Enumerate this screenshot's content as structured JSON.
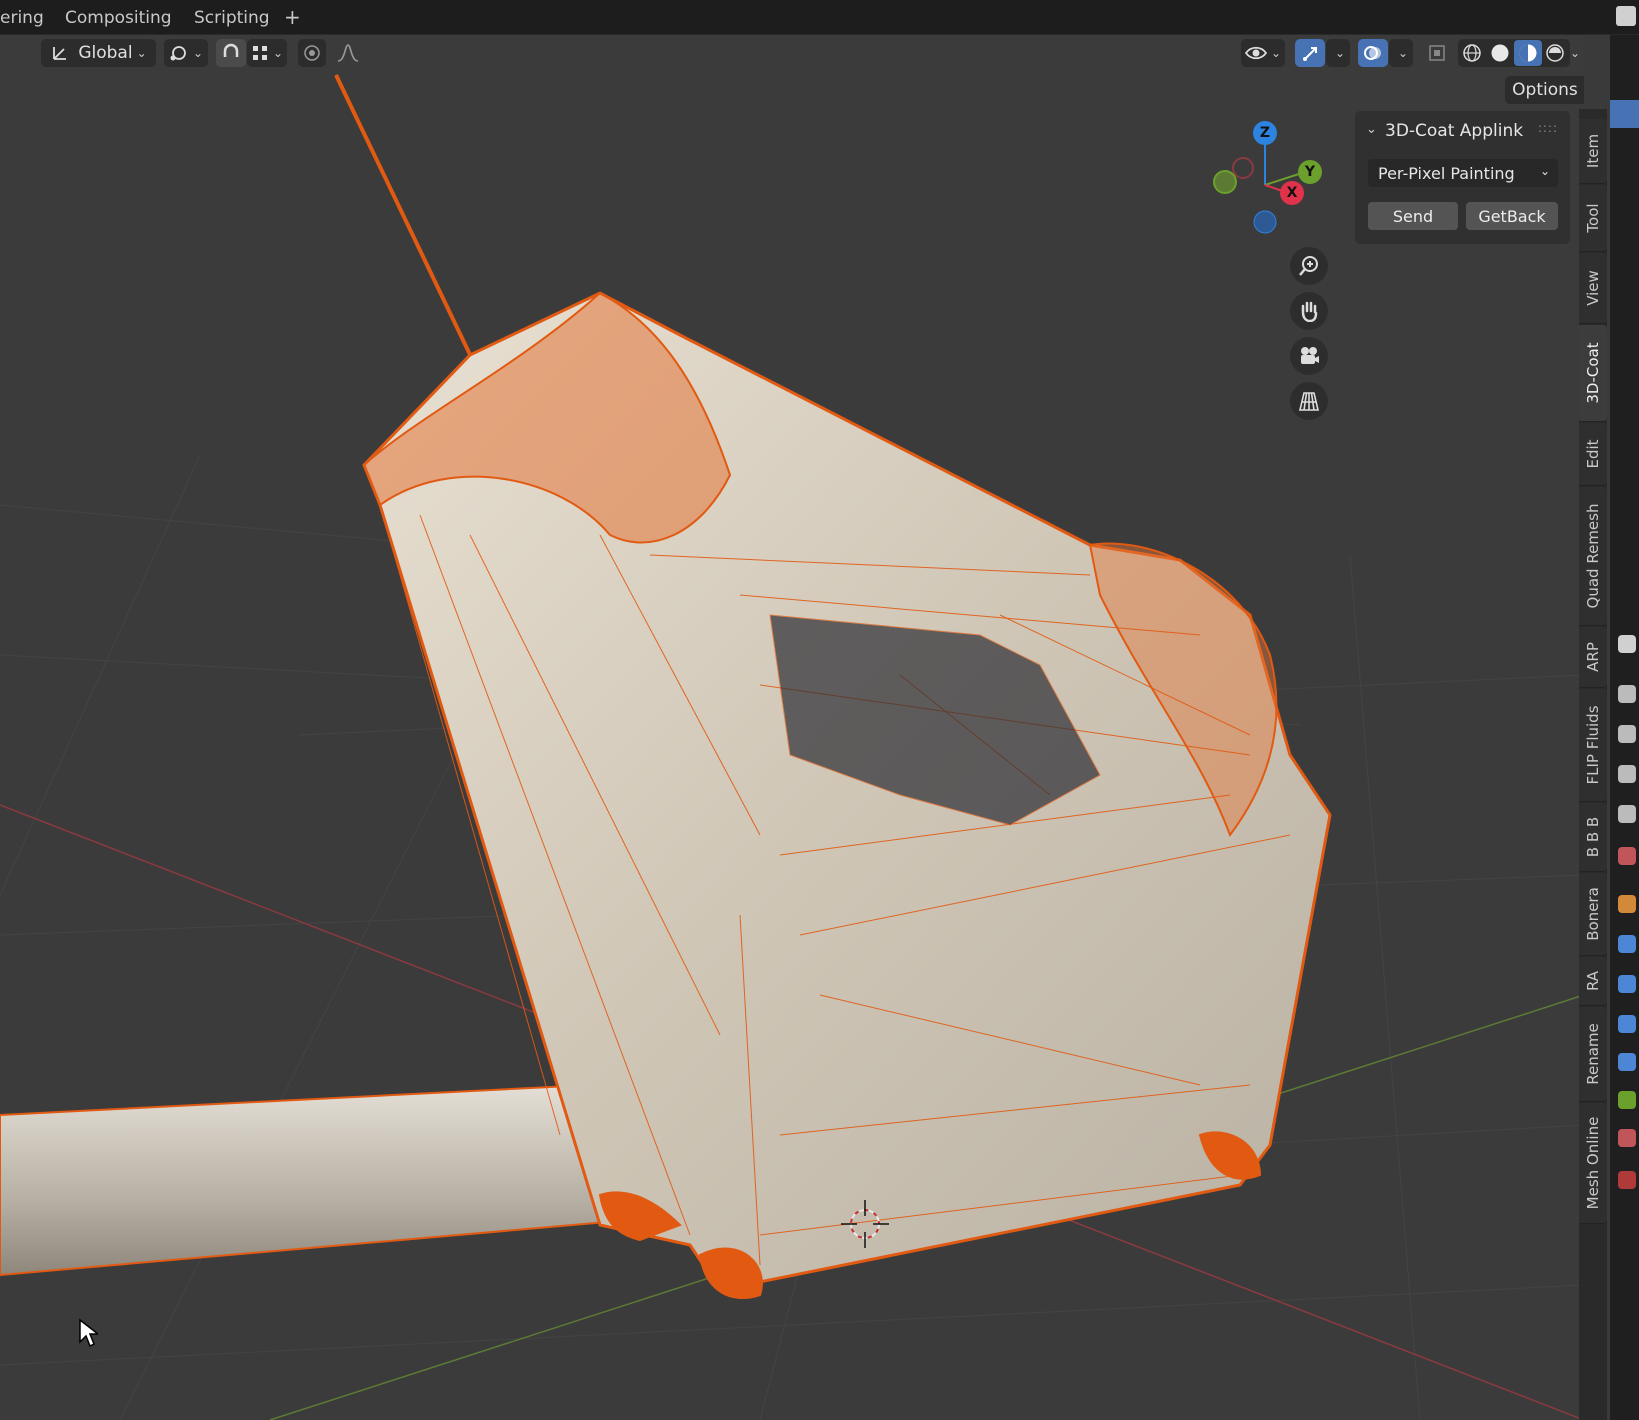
{
  "workspace_tabs": [
    "ering",
    "Compositing",
    "Scripting",
    "+"
  ],
  "header": {
    "transform_orientation": "Global",
    "options_label": "Options",
    "icons": [
      "transform-orientation-icon",
      "pivot-icon",
      "snap-icon",
      "snap-grid-icon",
      "proportional-edit-icon",
      "falloff-curve-icon",
      "visibility-icon",
      "gizmo-icon",
      "overlay-icon",
      "xray-icon",
      "wireframe-shading-icon",
      "solid-shading-icon",
      "material-shading-icon",
      "rendered-shading-icon"
    ]
  },
  "gizmo": {
    "axes": {
      "z": "Z",
      "y": "Y",
      "x": "X"
    }
  },
  "panel": {
    "title": "3D-Coat Applink",
    "mode_value": "Per-Pixel Painting",
    "send_label": "Send",
    "getback_label": "GetBack"
  },
  "sidebar_tabs": [
    {
      "label": "Item",
      "active": false
    },
    {
      "label": "Tool",
      "active": false
    },
    {
      "label": "View",
      "active": false
    },
    {
      "label": "3D-Coat",
      "active": true
    },
    {
      "label": "Edit",
      "active": false
    },
    {
      "label": "Quad Remesh",
      "active": false
    },
    {
      "label": "ARP",
      "active": false
    },
    {
      "label": "FLIP Fluids",
      "active": false
    },
    {
      "label": "B B B",
      "active": false
    },
    {
      "label": "Bonera",
      "active": false
    },
    {
      "label": "RA",
      "active": false
    },
    {
      "label": "Rename",
      "active": false
    },
    {
      "label": "Mesh Online",
      "active": false
    }
  ],
  "colors": {
    "accent_blue": "#4772b3",
    "selection_orange": "#e25a12",
    "mesh_surface": "#d8cfc0",
    "axis_x": "#e0324b",
    "axis_y": "#6ca02c",
    "axis_z": "#2d83e0"
  }
}
